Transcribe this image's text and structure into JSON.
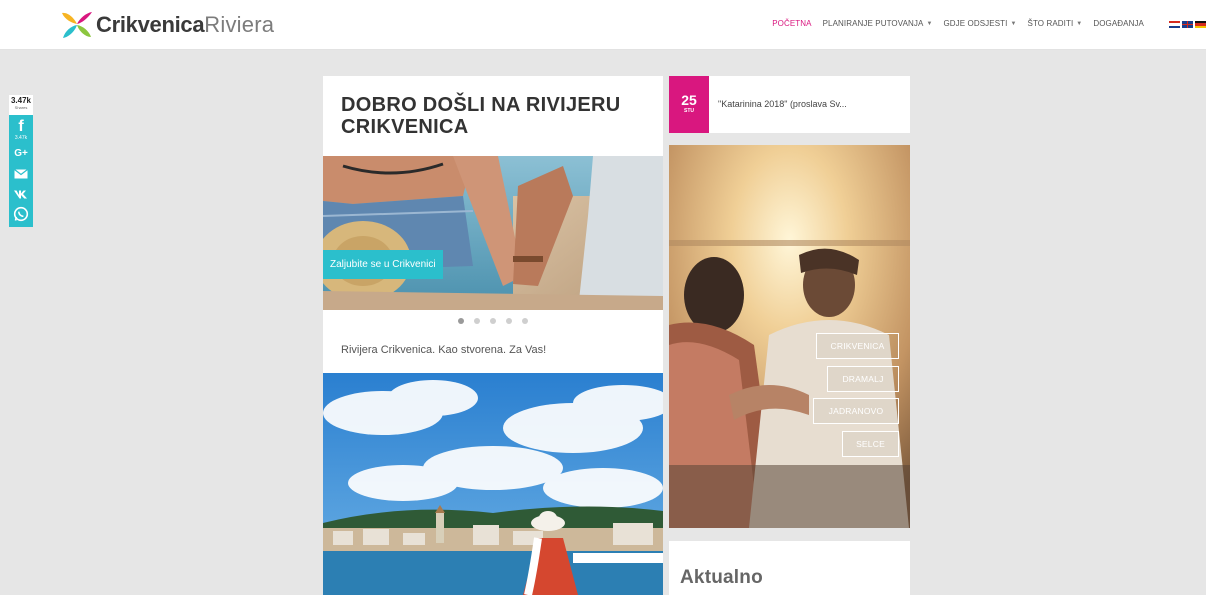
{
  "brand": {
    "name_bold": "Crikvenica",
    "name_light": "Riviera"
  },
  "nav": {
    "items": [
      {
        "label": "POČETNA",
        "active": true,
        "dropdown": false
      },
      {
        "label": "PLANIRANJE PUTOVANJA",
        "active": false,
        "dropdown": true
      },
      {
        "label": "GDJE ODSJESTI",
        "active": false,
        "dropdown": true
      },
      {
        "label": "ŠTO RADITI",
        "active": false,
        "dropdown": true
      },
      {
        "label": "DOGAĐANJA",
        "active": false,
        "dropdown": false
      }
    ],
    "caret": "▼",
    "languages": [
      "hr",
      "en",
      "de"
    ]
  },
  "share": {
    "total": "3.47k",
    "total_label": "Shares",
    "facebook_icon": "f",
    "facebook_count": "3.47k",
    "googleplus_icon": "G+",
    "icons": [
      "facebook-icon",
      "google-plus-icon",
      "mail-icon",
      "vk-icon",
      "whatsapp-icon"
    ]
  },
  "main": {
    "title": "DOBRO DOŠLI NA RIVIJERU CRIKVENICA",
    "slider": {
      "caption": "Zaljubite se u Crikvenici",
      "dot_count": 5,
      "active_dot": 0
    },
    "tagline": "Rivijera Crikvenica. Kao stvorena. Za Vas!"
  },
  "event": {
    "day": "25",
    "month": "STU",
    "title": "\"Katarinina 2018\" (proslava Sv..."
  },
  "destinations": [
    {
      "label": "CRIKVENICA"
    },
    {
      "label": "DRAMALJ"
    },
    {
      "label": "JADRANOVO"
    },
    {
      "label": "SELCE"
    }
  ],
  "aktualno": {
    "title": "Aktualno"
  },
  "colors": {
    "accent_pink": "#d9177f",
    "accent_teal": "#2bbfcc",
    "background": "#e6e6e6"
  }
}
